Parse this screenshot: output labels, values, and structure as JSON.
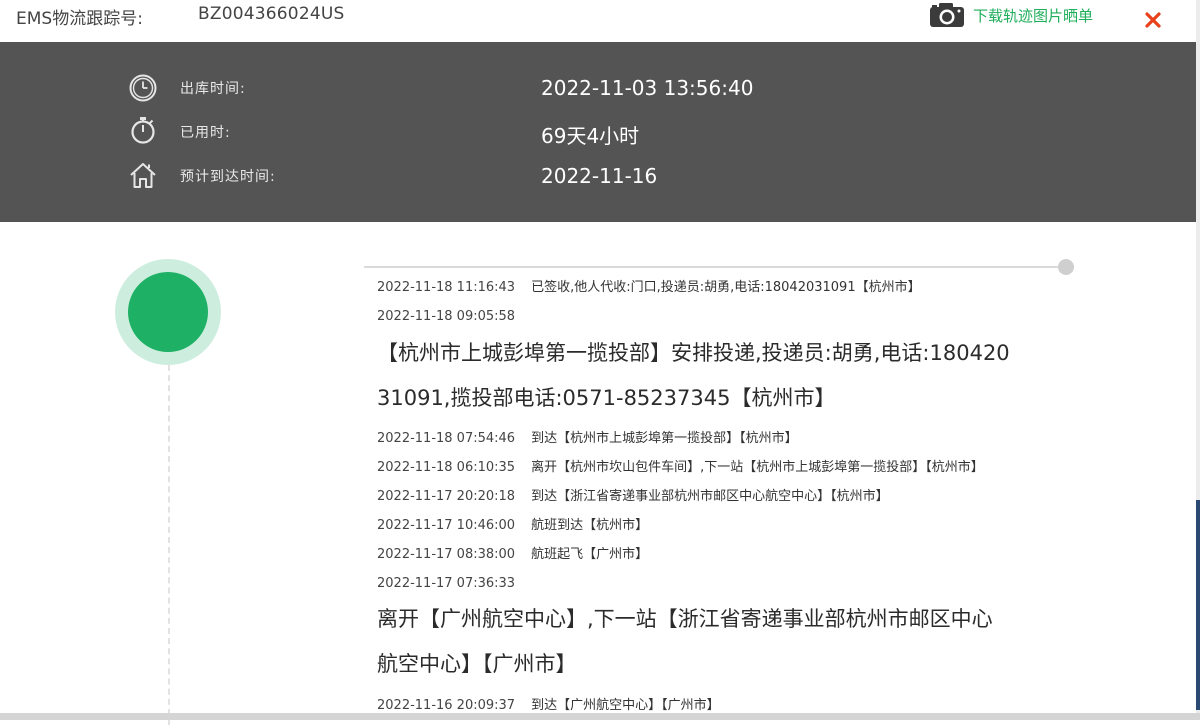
{
  "header": {
    "tracking_label": "EMS物流跟踪号:",
    "tracking_number": "BZ004366024US",
    "download_label": "下载轨迹图片晒单",
    "accent_color": "#1fae5a",
    "close_color": "#e8411b"
  },
  "info": {
    "rows": [
      {
        "icon": "clock-icon",
        "label": "出库时间:",
        "value": "2022-11-03 13:56:40"
      },
      {
        "icon": "stopwatch-icon",
        "label": "已用时:",
        "value": "69天4小时"
      },
      {
        "icon": "home-icon",
        "label": "预计到达时间:",
        "value": "2022-11-16"
      }
    ],
    "panel_color": "#545454"
  },
  "status": {
    "color": "#1eb064"
  },
  "events": [
    {
      "time": "2022-11-18 11:16:43",
      "desc": "已签收,他人代收:门口,投递员:胡勇,电话:18042031091【杭州市】"
    },
    {
      "time": "2022-11-18 09:05:58",
      "desc": ""
    },
    {
      "big_line1": "【杭州市上城彭埠第一揽投部】安排投递,投递员:胡勇,电话:180420",
      "big_line2": "31091,揽投部电话:0571-85237345【杭州市】"
    },
    {
      "time": "2022-11-18 07:54:46",
      "desc": "到达【杭州市上城彭埠第一揽投部】【杭州市】"
    },
    {
      "time": "2022-11-18 06:10:35",
      "desc": "离开【杭州市坎山包件车间】,下一站【杭州市上城彭埠第一揽投部】【杭州市】"
    },
    {
      "time": "2022-11-17 20:20:18",
      "desc": "到达【浙江省寄递事业部杭州市邮区中心航空中心】【杭州市】"
    },
    {
      "time": "2022-11-17 10:46:00",
      "desc": "航班到达【杭州市】"
    },
    {
      "time": "2022-11-17 08:38:00",
      "desc": "航班起飞【广州市】"
    },
    {
      "time": "2022-11-17 07:36:33",
      "desc": ""
    },
    {
      "big_line1": "离开【广州航空中心】,下一站【浙江省寄递事业部杭州市邮区中心",
      "big_line2": "航空中心】【广州市】"
    },
    {
      "time": "2022-11-16 20:09:37",
      "desc": "到达【广州航空中心】【广州市】"
    }
  ]
}
